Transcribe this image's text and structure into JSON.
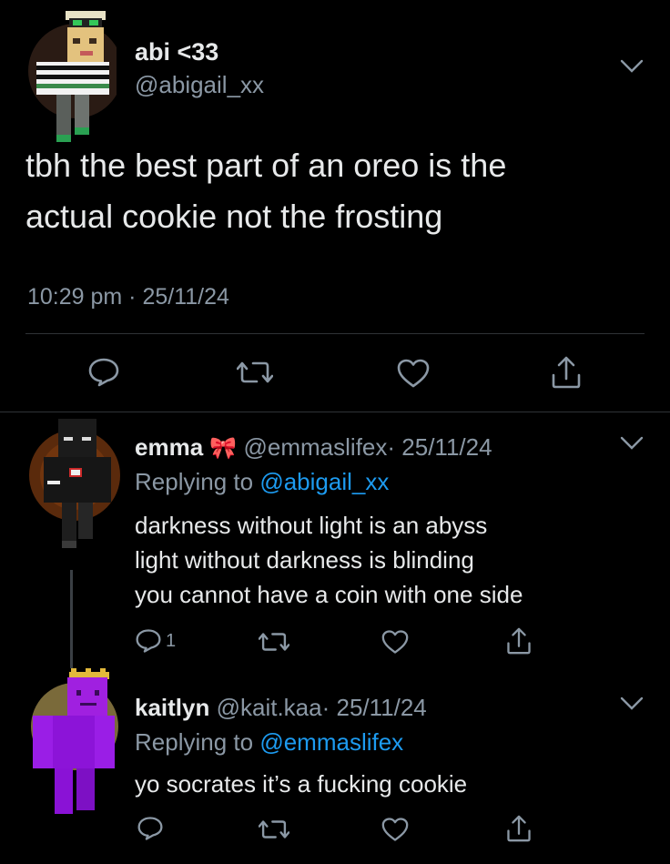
{
  "main_tweet": {
    "display_name": "abi <33",
    "handle": "@abigail_xx",
    "text_line1": "tbh the best part of an oreo is the",
    "text_line2": "actual cookie not the frosting",
    "timestamp": "10:29 pm · 25/11/24"
  },
  "replies": [
    {
      "display_name": "emma",
      "name_emoji": "🎀",
      "handle": "@emmaslifex",
      "date": "· 25/11/24",
      "replying_prefix": "Replying to",
      "replying_to": "@abigail_xx",
      "line1": "darkness without light is an abyss",
      "line2": "light without darkness is blinding",
      "line3": "you cannot have a coin with one side",
      "reply_count": "1"
    },
    {
      "display_name": "kaitlyn",
      "handle": "@kait.kaa",
      "date": "· 25/11/24",
      "replying_prefix": "Replying to",
      "replying_to": "@emmaslifex",
      "line1": "yo socrates it’s a fucking cookie"
    }
  ],
  "icons": {
    "reply": "reply-icon",
    "retweet": "retweet-icon",
    "like": "heart-icon",
    "share": "share-icon",
    "more": "chevron-down-icon"
  },
  "colors": {
    "background": "#000000",
    "text": "#e7e9ea",
    "muted": "#8b98a5",
    "link": "#1d9bf0"
  }
}
